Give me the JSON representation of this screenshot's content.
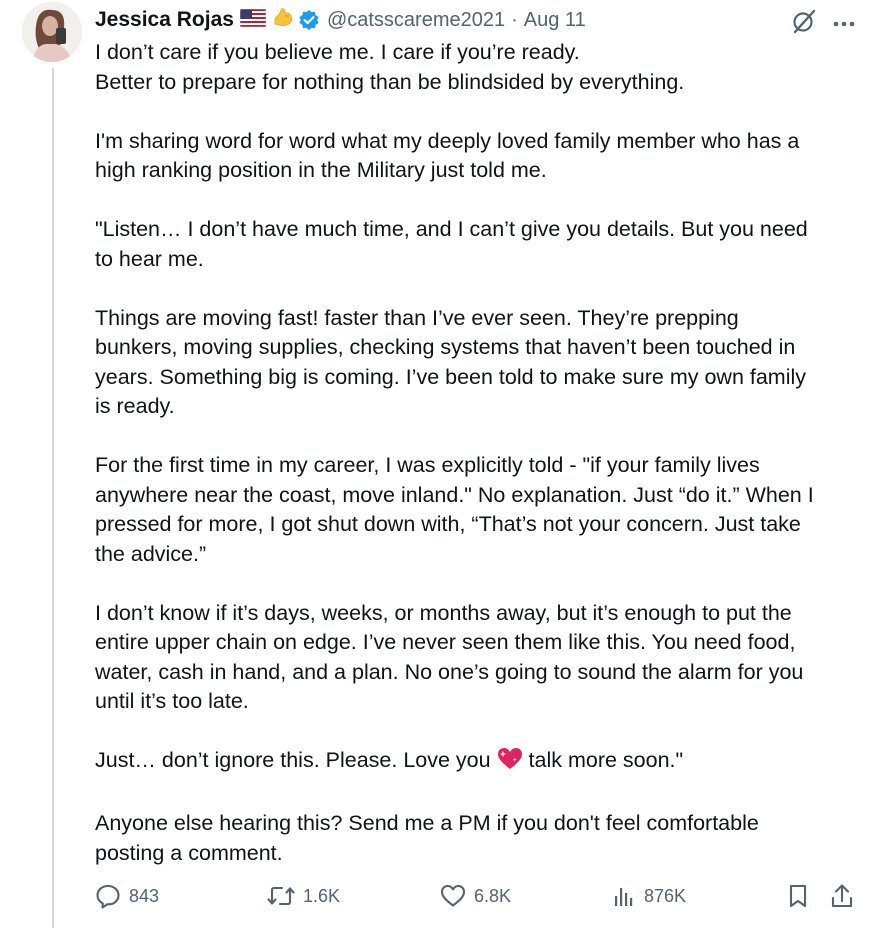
{
  "author": {
    "name": "Jessica Rojas",
    "handle": "@catsscareme2021",
    "separator": "·",
    "date": "Aug 11",
    "badges": [
      "us-flag-icon",
      "flexed-biceps-icon",
      "verified-badge-icon"
    ]
  },
  "post": {
    "paragraphs": [
      [
        "I don’t care if you believe me. I care if you’re ready.",
        "Better to prepare for nothing than be blindsided by everything."
      ],
      [
        "I'm sharing word for word what my deeply loved family member who has a",
        "high ranking position in the Military just told me."
      ],
      [
        "\"Listen… I don’t have much time, and I can’t give you details. But you need",
        "to hear me."
      ],
      [
        "Things are moving fast!  faster than I’ve ever seen. They’re prepping",
        "bunkers, moving supplies, checking systems that haven’t been touched in",
        "years. Something big is coming. I’ve been told to make sure my own family",
        "is ready."
      ],
      [
        "For the first time in my career, I was explicitly told - \"if your family lives",
        "anywhere near the coast, move inland.\"  No explanation. Just “do it.” When I",
        "pressed for more, I got shut down with, “That’s not your concern. Just take",
        "the advice.”"
      ],
      [
        "I don’t know if it’s days, weeks, or months away, but it’s enough to put the",
        "entire upper chain on edge. I’ve never seen them like this. You need food,",
        "water, cash in hand, and a plan. No one’s going to sound the alarm for you",
        "until it’s too late."
      ],
      [
        "Just… don’t ignore this. Please. Love you ",
        " talk more soon.\""
      ],
      [
        "Anyone else hearing this? Send me a PM if you don't feel comfortable",
        "posting a comment."
      ]
    ],
    "inline_emoji": "heart-with-sparkles-icon"
  },
  "actions": {
    "replies": "843",
    "reposts": "1.6K",
    "likes": "6.8K",
    "views": "876K"
  },
  "colors": {
    "text": "#0f1419",
    "secondary": "#536471",
    "verified": "#1d9bf0",
    "thread_line": "#cfd9de"
  }
}
